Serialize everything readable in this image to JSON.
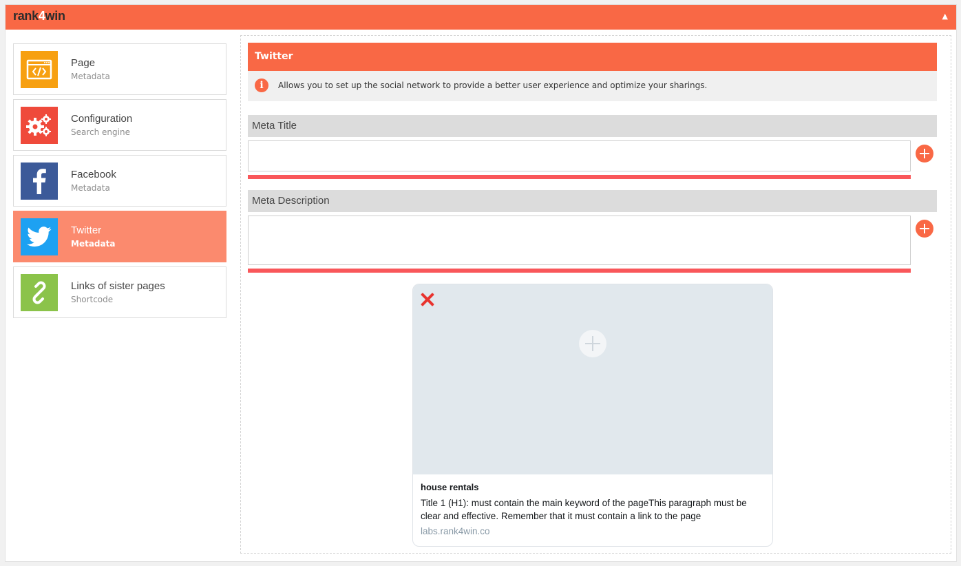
{
  "brand": {
    "logo_pre": "rank",
    "logo_four": "4",
    "logo_post": "win"
  },
  "colors": {
    "accent": "#f96845",
    "active_item": "#fb8a6e",
    "error_rule": "#f9575a"
  },
  "sidebar": {
    "items": [
      {
        "title": "Page",
        "subtitle": "Metadata",
        "icon": "code-window-icon",
        "icon_bg": "#f7a011"
      },
      {
        "title": "Configuration",
        "subtitle": "Search engine",
        "icon": "gears-icon",
        "icon_bg": "#ef4a3b"
      },
      {
        "title": "Facebook",
        "subtitle": "Metadata",
        "icon": "facebook-icon",
        "icon_bg": "#3c5a99"
      },
      {
        "title": "Twitter",
        "subtitle": "Metadata",
        "icon": "twitter-bird-icon",
        "icon_bg": "#1da1f2",
        "active": true
      },
      {
        "title": "Links of sister pages",
        "subtitle": "Shortcode",
        "icon": "link-icon",
        "icon_bg": "#8bc34a"
      }
    ]
  },
  "main": {
    "section_title": "Twitter",
    "info_text": "Allows you to set up the social network to provide a better user experience and optimize your sharings.",
    "meta_title": {
      "label": "Meta Title",
      "value": ""
    },
    "meta_description": {
      "label": "Meta Description",
      "value": ""
    }
  },
  "preview_card": {
    "title": "house rentals",
    "description": "Title 1 (H1): must contain the main keyword of the pageThis paragraph must be clear and effective. Remember that it must contain a link to the page",
    "url": "labs.rank4win.co"
  }
}
